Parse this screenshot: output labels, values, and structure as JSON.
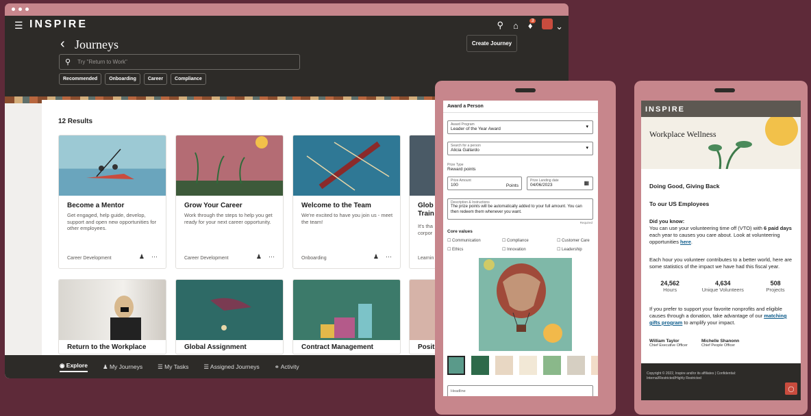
{
  "brand": "INSPIRE",
  "colors": {
    "background": "#5e2a39",
    "frame": "#c7868c",
    "dark": "#2d2b28",
    "accent": "#c94c3e"
  },
  "header": {
    "title": "Journeys",
    "create_label": "Create Journey",
    "notification_count": "3"
  },
  "search": {
    "placeholder": "Try \"Return to Work\""
  },
  "filters": [
    "Recommended",
    "Onboarding",
    "Career",
    "Compliance"
  ],
  "results": {
    "count_label": "12 Results"
  },
  "cards": [
    {
      "title": "Become a Mentor",
      "desc": "Get engaged, help guide, develop, support and open new opportunities for other employees.",
      "category": "Career Development"
    },
    {
      "title": "Grow Your Career",
      "desc": "Work through the steps to help you get ready for your next career opportunity.",
      "category": "Career Development"
    },
    {
      "title": "Welcome to the Team",
      "desc": "We're excited to have you join us - meet the team!",
      "category": "Onboarding"
    },
    {
      "title": "Glob Train",
      "desc": "It's tha corpor",
      "category": "Learnin"
    },
    {
      "title": "Return to the Workplace"
    },
    {
      "title": "Global Assignment"
    },
    {
      "title": "Contract Management"
    },
    {
      "title": "Posit"
    }
  ],
  "bottom_nav": [
    "Explore",
    "My Journeys",
    "My Tasks",
    "Assigned Journeys",
    "Activity"
  ],
  "award": {
    "title": "Award a Person",
    "program_label": "Award Program",
    "program_value": "Leader of the Year Award",
    "person_label": "Search for a person",
    "person_value": "Alicia Gallardo",
    "prize_type_label": "Prize Type",
    "prize_type_value": "Reward points",
    "prize_amount_label": "Prize Amount",
    "prize_amount_value": "100",
    "prize_unit": "Points",
    "date_label": "Prize Landing date",
    "date_value": "04/06/2023",
    "desc_label": "Description & Instructions",
    "desc_value": "The prize points will be automatically added to your full amount. You can then redeem them whenever you want.",
    "required": "Required",
    "core_values_label": "Core values",
    "core_values": [
      "Communication",
      "Compliance",
      "Customer Care",
      "Ethics",
      "Innovation",
      "Leadership"
    ],
    "headline_label": "Headline"
  },
  "wellness": {
    "brand": "INSPIRE",
    "title": "Workplace Wellness",
    "heading": "Doing Good, Giving Back",
    "to_line": "To our US Employees",
    "did_you_know": "Did you know:",
    "p1_a": "You can use your volunteering time off (VTO) with ",
    "p1_bold": "6 paid days",
    "p1_b": " each year to causes you care about. Look at volunteering opportunities ",
    "p1_link": "here",
    "p2": "Each hour you volunteer contributes to a better world, here are some statistics of the impact we have had this fiscal year.",
    "stats": [
      {
        "num": "24,562",
        "label": "Hours"
      },
      {
        "num": "4,634",
        "label": "Unique Volunteers"
      },
      {
        "num": "508",
        "label": "Projects"
      }
    ],
    "p3_a": "If you prefer to support your favorite nonprofits and eligible causes through a donation, take advantage of our ",
    "p3_link": "matching gifts program",
    "p3_b": " to amplify your impact.",
    "signers": [
      {
        "name": "William Taylor",
        "role": "Chief Executive Officer"
      },
      {
        "name": "Michelle Shanonn",
        "role": "Chief People Officer"
      }
    ],
    "footer": "Copyright © 2022, Inspire and/or its affiliates | Confidential: Internal/Restricted/Highly Restricted"
  }
}
